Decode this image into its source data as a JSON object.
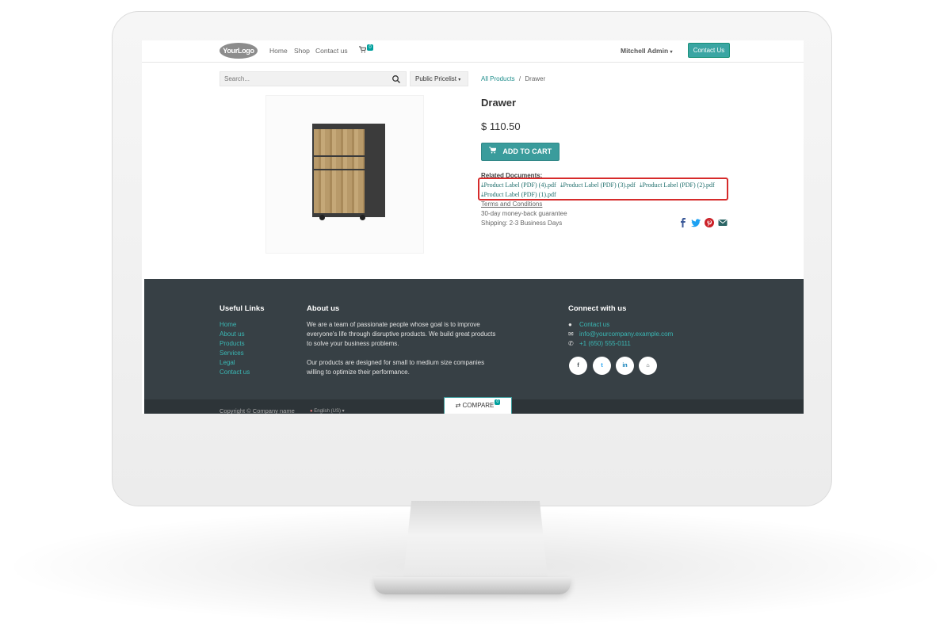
{
  "navbar": {
    "logo": "YourLogo",
    "links": [
      "Home",
      "Shop",
      "Contact us"
    ],
    "cart_count": "0",
    "user": "Mitchell Admin",
    "contact_button": "Contact Us"
  },
  "search": {
    "placeholder": "Search...",
    "pricelist": "Public Pricelist"
  },
  "breadcrumb": {
    "parent": "All Products",
    "separator": "/",
    "current": "Drawer"
  },
  "product": {
    "name": "Drawer",
    "price": "$ 110.50",
    "add_to_cart": "ADD TO CART",
    "related_label": "Related Documents:",
    "documents": [
      "Product Label (PDF) (4).pdf",
      "Product Label (PDF) (3).pdf",
      "Product Label (PDF) (2).pdf",
      "Product Label (PDF) (1).pdf"
    ],
    "terms": "Terms and Conditions",
    "guarantee": "30-day money-back guarantee",
    "shipping": "Shipping: 2-3 Business Days"
  },
  "footer": {
    "useful_links_title": "Useful Links",
    "useful_links": [
      "Home",
      "About us",
      "Products",
      "Services",
      "Legal",
      "Contact us"
    ],
    "about_title": "About us",
    "about_p1_lines": [
      "We are a team of passionate people whose goal is to improve",
      "everyone's life through disruptive products. We build great products",
      "to solve your business problems."
    ],
    "about_p2_lines": [
      "Our products are designed for small to medium size companies",
      "willing to optimize their performance."
    ],
    "connect_title": "Connect with us",
    "contact_us": "Contact us",
    "email": "info@yourcompany.example.com",
    "phone": "+1 (650) 555-0111",
    "copyright": "Copyright © Company name",
    "language": "English (US)"
  },
  "compare": {
    "label": "COMPARE",
    "count": "0"
  },
  "colors": {
    "accent": "#3a9c9c",
    "footer_bg": "#374045",
    "highlight": "#d62b2b"
  }
}
